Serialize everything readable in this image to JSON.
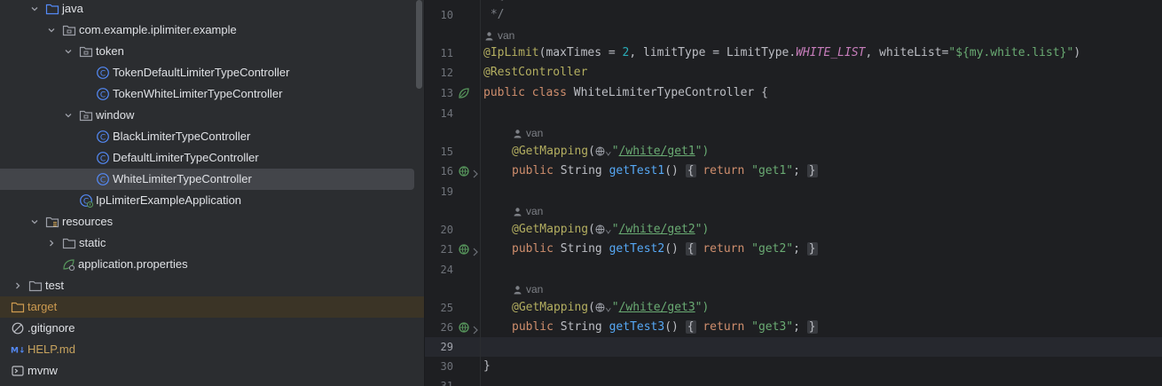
{
  "tree": {
    "items": [
      {
        "label": "java",
        "icon": "folder-source-icon"
      },
      {
        "label": "com.example.iplimiter.example",
        "icon": "package-icon"
      },
      {
        "label": "token",
        "icon": "package-icon"
      },
      {
        "label": "TokenDefaultLimiterTypeController",
        "icon": "class-icon"
      },
      {
        "label": "TokenWhiteLimiterTypeController",
        "icon": "class-icon"
      },
      {
        "label": "window",
        "icon": "package-icon"
      },
      {
        "label": "BlackLimiterTypeController",
        "icon": "class-icon"
      },
      {
        "label": "DefaultLimiterTypeController",
        "icon": "class-icon"
      },
      {
        "label": "WhiteLimiterTypeController",
        "icon": "class-icon"
      },
      {
        "label": "IpLimiterExampleApplication",
        "icon": "spring-boot-class-icon"
      },
      {
        "label": "resources",
        "icon": "folder-resources-icon"
      },
      {
        "label": "static",
        "icon": "folder-icon"
      },
      {
        "label": "application.properties",
        "icon": "spring-properties-icon"
      },
      {
        "label": "test",
        "icon": "folder-icon"
      },
      {
        "label": "target",
        "icon": "folder-excluded-icon"
      },
      {
        "label": ".gitignore",
        "icon": "gitignore-icon"
      },
      {
        "label": "HELP.md",
        "icon": "markdown-icon"
      },
      {
        "label": "mvnw",
        "icon": "shell-script-icon"
      }
    ]
  },
  "editor": {
    "author": "van",
    "line_numbers": [
      "10",
      "11",
      "12",
      "13",
      "14",
      "15",
      "16",
      "19",
      "20",
      "21",
      "24",
      "25",
      "26",
      "29",
      "30",
      "31"
    ],
    "code": {
      "comment_open": "  {",
      "comment_close": " */",
      "l11_a": "@IpLimit",
      "l11_b": "(maxTimes = ",
      "l11_c": "2",
      "l11_d": ", limitType = LimitType.",
      "l11_e": "WHITE_LIST",
      "l11_f": ", whiteList=",
      "l11_g": "\"${my.white.list}\"",
      "l11_h": ")",
      "l12": "@RestController",
      "l13_a": "public class ",
      "l13_b": "WhiteLimiterTypeController {",
      "getmapping": "@GetMapping",
      "paren_open": "(",
      "globe_chev": "⌄",
      "quote": "\"",
      "paths": [
        "/white/get1",
        "/white/get2",
        "/white/get3"
      ],
      "paren_close": "\")",
      "public_kw": "public ",
      "string_type": "String ",
      "methods": [
        "getTest1",
        "getTest2",
        "getTest3"
      ],
      "parens": "()",
      "fold_open": "{",
      "return_kw": "return ",
      "returns": [
        "\"get1\"",
        "\"get2\"",
        "\"get3\""
      ],
      "semi": ";",
      "fold_close": "}",
      "close_brace": "}"
    }
  }
}
